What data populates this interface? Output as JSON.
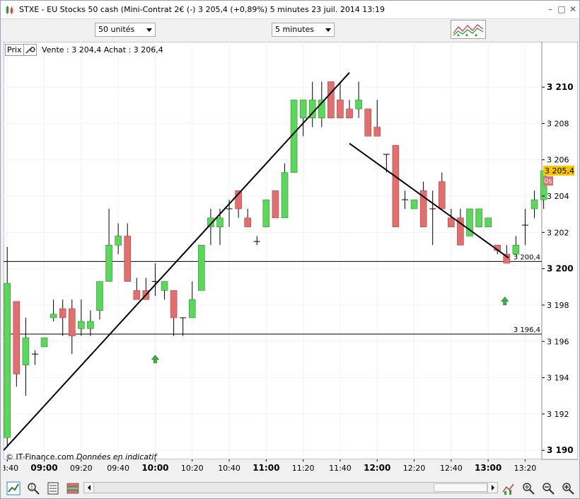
{
  "window": {
    "title": "STXE - EU Stocks 50 cash (Mini-Contrat 2€ (-)     3 205,4 (+0,89%)     5 minutes  23 juil. 2014 13:19"
  },
  "toolbar": {
    "units_select": "50 unités",
    "interval_select": "5 minutes"
  },
  "chart_header": {
    "tab_label": "Prix",
    "bid_ask": "Vente : 3 204,4 Achat : 3 206,4"
  },
  "footer": {
    "copyright": "© IT-Finance.com",
    "note": "Données en indicatif"
  },
  "colors": {
    "up": "#5cd65c",
    "down": "#e07070",
    "current_price_bg": "#f7c600",
    "countdown_bg": "#e07070"
  },
  "icons": [
    "chart-line-icon",
    "magnifier-target-icon",
    "spreadsheet-icon",
    "indicator-list-icon",
    "indicators-icon",
    "zoom-target-icon",
    "zoom-out-icon",
    "zoom-in-icon"
  ],
  "chart_data": {
    "type": "candlestick",
    "y_axis": {
      "range": [
        3189.5,
        3212.5
      ],
      "ticks": [
        "3 190",
        "3 192",
        "3 194",
        "3 196",
        "3 198",
        "3 200",
        "3 202",
        "3 204",
        "3 206",
        "3 208",
        "3 210"
      ],
      "tick_values": [
        3190,
        3192,
        3194,
        3196,
        3198,
        3200,
        3202,
        3204,
        3206,
        3208,
        3210
      ],
      "bold_ticks": [
        3190,
        3200,
        3210
      ]
    },
    "x_axis": {
      "range": [
        "08:38",
        "13:29"
      ],
      "ticks": [
        "08:40",
        "09:00",
        "09:20",
        "09:40",
        "10:00",
        "10:20",
        "10:40",
        "11:00",
        "11:20",
        "11:40",
        "12:00",
        "12:20",
        "12:40",
        "13:00",
        "13:20"
      ],
      "bold_ticks": [
        "09:00",
        "10:00",
        "11:00",
        "12:00",
        "13:00"
      ]
    },
    "current_price": {
      "label": "3 205,4",
      "value": 3205.4
    },
    "countdown": "0s",
    "candles": [
      {
        "t": "08:40",
        "o": 3190.7,
        "h": 3201.2,
        "l": 3190.2,
        "c": 3199.2
      },
      {
        "t": "08:45",
        "o": 3198.2,
        "h": 3198.2,
        "l": 3193.5,
        "c": 3194.2
      },
      {
        "t": "08:50",
        "o": 3194.7,
        "h": 3197.3,
        "l": 3193.0,
        "c": 3196.2
      },
      {
        "t": "08:55",
        "o": 3195.3,
        "h": 3195.5,
        "l": 3194.7,
        "c": 3195.3
      },
      {
        "t": "09:00",
        "o": 3195.7,
        "h": 3196.2,
        "l": 3195.7,
        "c": 3196.2
      },
      {
        "t": "09:05",
        "o": 3197.3,
        "h": 3198.3,
        "l": 3197.1,
        "c": 3197.5
      },
      {
        "t": "09:10",
        "o": 3197.8,
        "h": 3198.3,
        "l": 3196.3,
        "c": 3197.3
      },
      {
        "t": "09:15",
        "o": 3197.8,
        "h": 3198.3,
        "l": 3195.3,
        "c": 3196.3
      },
      {
        "t": "09:20",
        "o": 3196.7,
        "h": 3198.3,
        "l": 3196.3,
        "c": 3197.1
      },
      {
        "t": "09:25",
        "o": 3196.7,
        "h": 3197.7,
        "l": 3196.3,
        "c": 3197.1
      },
      {
        "t": "09:30",
        "o": 3197.7,
        "h": 3199.3,
        "l": 3197.2,
        "c": 3199.3
      },
      {
        "t": "09:35",
        "o": 3199.3,
        "h": 3203.3,
        "l": 3199.3,
        "c": 3201.3
      },
      {
        "t": "09:40",
        "o": 3201.3,
        "h": 3202.5,
        "l": 3200.8,
        "c": 3201.8
      },
      {
        "t": "09:45",
        "o": 3201.8,
        "h": 3202.5,
        "l": 3199.3,
        "c": 3199.3
      },
      {
        "t": "09:50",
        "o": 3198.8,
        "h": 3199.5,
        "l": 3198.3,
        "c": 3198.3
      },
      {
        "t": "09:55",
        "o": 3198.8,
        "h": 3199.5,
        "l": 3198.3,
        "c": 3198.3
      },
      {
        "t": "10:00",
        "o": 3199.3,
        "h": 3200.3,
        "l": 3198.5,
        "c": 3199.3
      },
      {
        "t": "10:05",
        "o": 3198.8,
        "h": 3199.3,
        "l": 3198.3,
        "c": 3199.3
      },
      {
        "t": "10:10",
        "o": 3198.8,
        "h": 3198.8,
        "l": 3196.3,
        "c": 3197.3
      },
      {
        "t": "10:15",
        "o": 3197.3,
        "h": 3197.3,
        "l": 3196.3,
        "c": 3197.3
      },
      {
        "t": "10:20",
        "o": 3197.3,
        "h": 3199.3,
        "l": 3197.3,
        "c": 3198.3
      },
      {
        "t": "10:25",
        "o": 3198.8,
        "h": 3201.3,
        "l": 3198.8,
        "c": 3201.3
      },
      {
        "t": "10:30",
        "o": 3202.3,
        "h": 3203.3,
        "l": 3201.3,
        "c": 3202.8
      },
      {
        "t": "10:35",
        "o": 3202.3,
        "h": 3203.3,
        "l": 3201.3,
        "c": 3202.8
      },
      {
        "t": "10:40",
        "o": 3203.3,
        "h": 3203.8,
        "l": 3202.3,
        "c": 3203.3
      },
      {
        "t": "10:45",
        "o": 3204.3,
        "h": 3204.3,
        "l": 3202.8,
        "c": 3203.3
      },
      {
        "t": "10:50",
        "o": 3202.8,
        "h": 3203.3,
        "l": 3202.3,
        "c": 3202.3
      },
      {
        "t": "10:55",
        "o": 3201.5,
        "h": 3201.8,
        "l": 3201.3,
        "c": 3201.5
      },
      {
        "t": "11:00",
        "o": 3202.3,
        "h": 3203.3,
        "l": 3202.3,
        "c": 3203.8
      },
      {
        "t": "11:05",
        "o": 3204.3,
        "h": 3204.3,
        "l": 3202.8,
        "c": 3202.8
      },
      {
        "t": "11:10",
        "o": 3202.8,
        "h": 3205.8,
        "l": 3202.8,
        "c": 3205.3
      },
      {
        "t": "11:15",
        "o": 3205.3,
        "h": 3208.8,
        "l": 3205.3,
        "c": 3209.3
      },
      {
        "t": "11:20",
        "o": 3208.3,
        "h": 3209.3,
        "l": 3207.3,
        "c": 3209.3
      },
      {
        "t": "11:25",
        "o": 3208.3,
        "h": 3210.3,
        "l": 3207.8,
        "c": 3209.3
      },
      {
        "t": "11:30",
        "o": 3208.3,
        "h": 3210.3,
        "l": 3207.8,
        "c": 3209.3
      },
      {
        "t": "11:35",
        "o": 3210.3,
        "h": 3210.3,
        "l": 3208.3,
        "c": 3208.3
      },
      {
        "t": "11:40",
        "o": 3209.3,
        "h": 3210.3,
        "l": 3208.3,
        "c": 3208.3
      },
      {
        "t": "11:45",
        "o": 3208.8,
        "h": 3209.3,
        "l": 3208.3,
        "c": 3208.3
      },
      {
        "t": "11:50",
        "o": 3208.8,
        "h": 3210.3,
        "l": 3208.3,
        "c": 3209.3
      },
      {
        "t": "11:55",
        "o": 3208.8,
        "h": 3208.8,
        "l": 3207.3,
        "c": 3207.3
      },
      {
        "t": "12:00",
        "o": 3207.8,
        "h": 3209.3,
        "l": 3207.3,
        "c": 3207.3
      },
      {
        "t": "12:05",
        "o": 3206.3,
        "h": 3206.3,
        "l": 3205.3,
        "c": 3206.3
      },
      {
        "t": "12:10",
        "o": 3206.8,
        "h": 3206.8,
        "l": 3202.3,
        "c": 3202.3
      },
      {
        "t": "12:15",
        "o": 3203.8,
        "h": 3204.3,
        "l": 3203.3,
        "c": 3203.8
      },
      {
        "t": "12:20",
        "o": 3203.3,
        "h": 3203.8,
        "l": 3203.3,
        "c": 3203.8
      },
      {
        "t": "12:25",
        "o": 3204.3,
        "h": 3204.8,
        "l": 3202.3,
        "c": 3202.3
      },
      {
        "t": "12:30",
        "o": 3203.3,
        "h": 3204.3,
        "l": 3201.3,
        "c": 3203.3
      },
      {
        "t": "12:35",
        "o": 3204.8,
        "h": 3205.3,
        "l": 3203.3,
        "c": 3203.3
      },
      {
        "t": "12:40",
        "o": 3202.8,
        "h": 3203.3,
        "l": 3202.3,
        "c": 3202.3
      },
      {
        "t": "12:45",
        "o": 3202.8,
        "h": 3203.3,
        "l": 3201.3,
        "c": 3201.3
      },
      {
        "t": "12:50",
        "o": 3201.8,
        "h": 3203.3,
        "l": 3201.8,
        "c": 3203.3
      },
      {
        "t": "12:55",
        "o": 3202.3,
        "h": 3203.3,
        "l": 3202.3,
        "c": 3203.3
      },
      {
        "t": "13:00",
        "o": 3202.3,
        "h": 3202.8,
        "l": 3202.3,
        "c": 3202.8
      },
      {
        "t": "13:05",
        "o": 3201.3,
        "h": 3201.3,
        "l": 3200.8,
        "c": 3201.0
      },
      {
        "t": "13:10",
        "o": 3200.8,
        "h": 3201.3,
        "l": 3200.3,
        "c": 3200.3
      },
      {
        "t": "13:15",
        "o": 3200.8,
        "h": 3201.8,
        "l": 3200.8,
        "c": 3201.3
      },
      {
        "t": "13:20",
        "o": 3202.4,
        "h": 3203.3,
        "l": 3201.3,
        "c": 3202.4
      },
      {
        "t": "13:25",
        "o": 3203.3,
        "h": 3204.3,
        "l": 3202.8,
        "c": 3203.8
      },
      {
        "t": "13:30",
        "o": 3203.8,
        "h": 3205.4,
        "l": 3203.3,
        "c": 3205.4
      }
    ],
    "horizontal_lines": [
      {
        "value": 3200.4,
        "label": "3 200,4"
      },
      {
        "value": 3196.4,
        "label": "3 196,4"
      }
    ],
    "trend_lines": [
      {
        "from": {
          "t": "08:38",
          "v": 3190.0
        },
        "to": {
          "t": "11:45",
          "v": 3210.8
        }
      },
      {
        "from": {
          "t": "11:45",
          "v": 3206.9
        },
        "to": {
          "t": "13:11",
          "v": 3200.6
        }
      }
    ],
    "signals": [
      {
        "t": "10:00",
        "v": 3195.0,
        "direction": "up"
      },
      {
        "t": "13:09",
        "v": 3198.2,
        "direction": "up"
      }
    ]
  }
}
